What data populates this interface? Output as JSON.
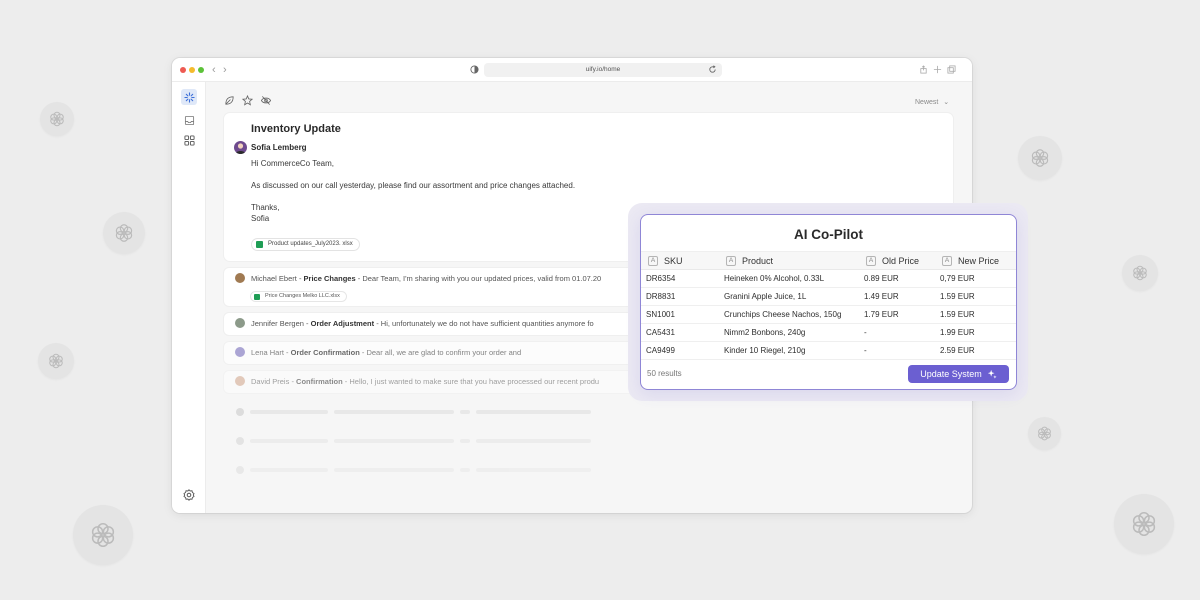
{
  "browser": {
    "url": "uify.io/home"
  },
  "toolbar": {
    "sort_label": "Newest"
  },
  "open_email": {
    "subject": "Inventory Update",
    "sender": "Sofia Lemberg",
    "greeting": "Hi CommerceCo Team,",
    "body": "As discussed on our call yesterday, please find our assortment and price changes attached.",
    "signoff_1": "Thanks,",
    "signoff_2": "Sofia",
    "attachment": "Product updates_July2023. xlsx"
  },
  "email_rows": [
    {
      "sender": "Michael Ebert",
      "subject": "Price Changes",
      "preview": "Dear Team, I'm sharing with you our updated prices, valid from 01.07.20",
      "attachment": "Price Changes Melko LLC.xlsx"
    },
    {
      "sender": "Jennifer Bergen",
      "subject": "Order Adjustment",
      "preview": "Hi, unfortunately we do not have sufficient quantities anymore fo"
    },
    {
      "sender": "Lena Hart",
      "subject": "Order Confirmation",
      "preview": "Dear all, we are glad to confirm your order and"
    },
    {
      "sender": "David Preis",
      "subject": "Confirmation",
      "preview": "Hello, I just wanted to make sure that you have processed our recent produ"
    }
  ],
  "separator": " - ",
  "copilot": {
    "title": "AI Co-Pilot",
    "columns": [
      "SKU",
      "Product",
      "Old Price",
      "New Price"
    ],
    "column_icon_glyph": "A",
    "rows": [
      {
        "sku": "DR6354",
        "product": "Heineken 0% Alcohol, 0.33L",
        "old": "0.89 EUR",
        "new": "0,79 EUR"
      },
      {
        "sku": "DR8831",
        "product": "Granini Apple Juice, 1L",
        "old": "1.49 EUR",
        "new": "1.59 EUR"
      },
      {
        "sku": "SN1001",
        "product": "Crunchips Cheese Nachos, 150g",
        "old": "1.79 EUR",
        "new": "1.59 EUR"
      },
      {
        "sku": "CA5431",
        "product": "Nimm2 Bonbons, 240g",
        "old": "-",
        "new": "1.99 EUR"
      },
      {
        "sku": "CA9499",
        "product": "Kinder 10 Riegel, 210g",
        "old": "-",
        "new": "2.59 EUR"
      }
    ],
    "results": "50 results",
    "button_label": "Update System"
  },
  "colors": {
    "accent": "#6b5fd1",
    "copilot_border": "#8f86d6",
    "traffic_red": "#ee5a52",
    "traffic_yellow": "#f4bb2d",
    "traffic_green": "#5cc238",
    "excel_green": "#1f9d55"
  }
}
